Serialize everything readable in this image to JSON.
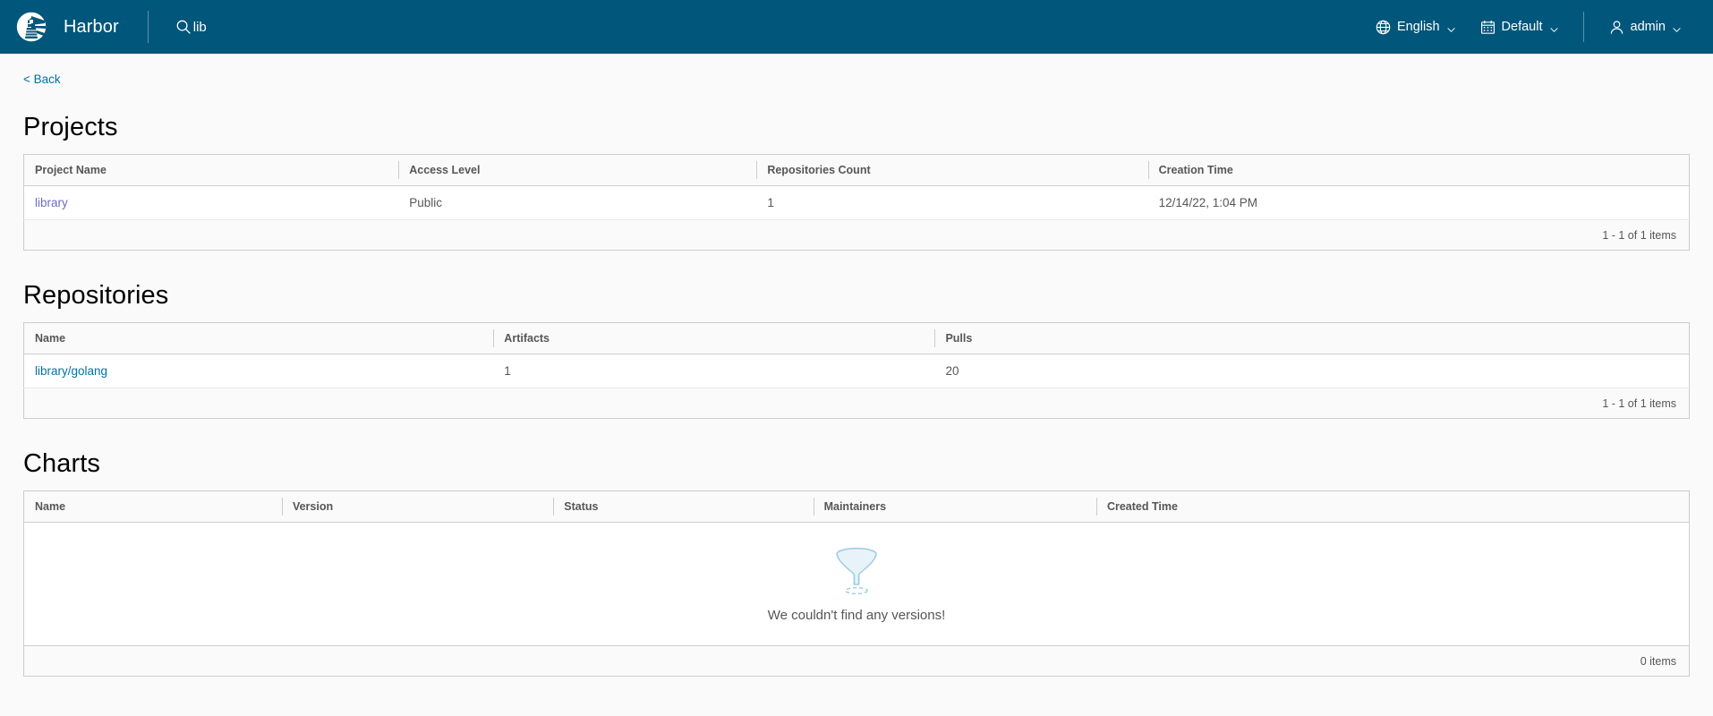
{
  "header": {
    "logo_icon": "harbor-lighthouse-logo",
    "title": "Harbor",
    "search": {
      "icon": "search-icon",
      "value": "lib",
      "placeholder": "Search Harbor..."
    },
    "language": {
      "icon": "globe-icon",
      "label": "English",
      "caret": "chevron-down-icon"
    },
    "theme": {
      "icon": "calendar-icon",
      "label": "Default",
      "caret": "chevron-down-icon"
    },
    "user": {
      "icon": "user-icon",
      "label": "admin",
      "caret": "chevron-down-icon"
    },
    "background_color": "#00567b"
  },
  "back_link": {
    "label": "< Back"
  },
  "projects": {
    "title": "Projects",
    "columns": [
      "Project Name",
      "Access Level",
      "Repositories Count",
      "Creation Time"
    ],
    "rows": [
      {
        "name": "library",
        "access_level": "Public",
        "repositories_count": "1",
        "creation_time": "12/14/22, 1:04 PM"
      }
    ],
    "footer": "1 - 1 of 1 items"
  },
  "repositories": {
    "title": "Repositories",
    "columns": [
      "Name",
      "Artifacts",
      "Pulls"
    ],
    "rows": [
      {
        "name": "library/golang",
        "artifacts": "1",
        "pulls": "20"
      }
    ],
    "footer": "1 - 1 of 1 items"
  },
  "charts": {
    "title": "Charts",
    "columns": [
      "Name",
      "Version",
      "Status",
      "Maintainers",
      "Created Time"
    ],
    "empty": {
      "icon": "funnel-icon",
      "message": "We couldn't find any versions!"
    },
    "footer": "0 items"
  },
  "colors": {
    "header_bg": "#00567b",
    "link": "#0072a3",
    "visited_link": "#6b6bc9",
    "page_bg": "#fafafa",
    "border": "#cccccc",
    "empty_icon": "#a3cde3"
  }
}
